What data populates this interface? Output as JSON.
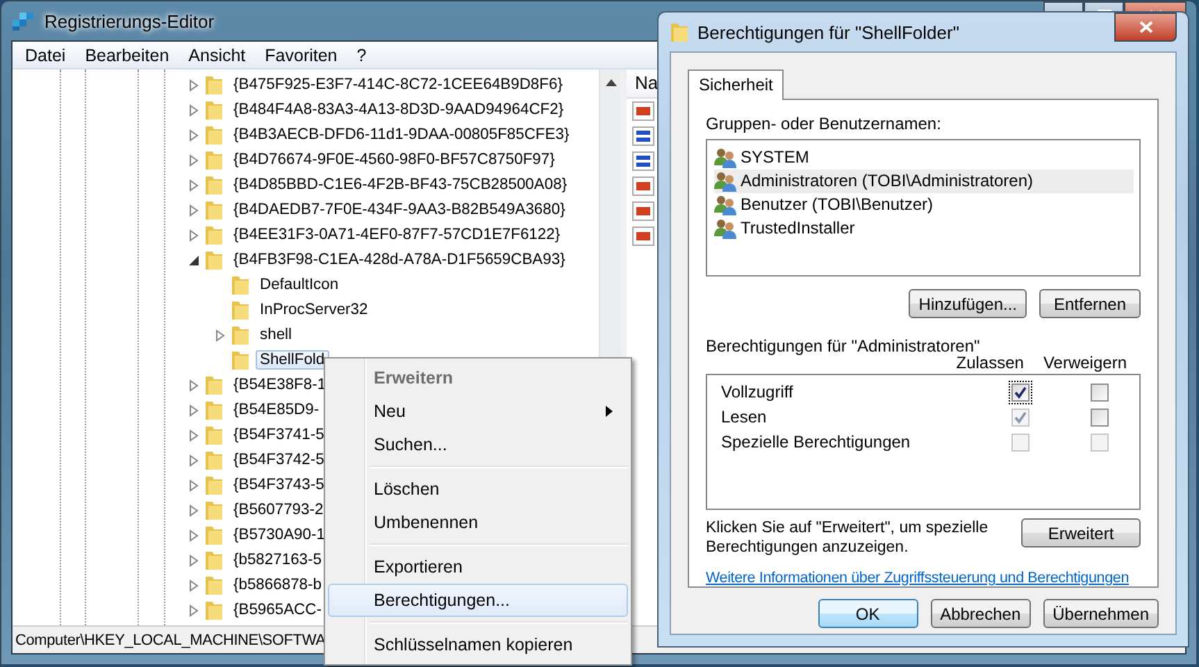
{
  "editor": {
    "title": "Registrierungs-Editor",
    "menu": [
      "Datei",
      "Bearbeiten",
      "Ansicht",
      "Favoriten",
      "?"
    ],
    "tree": [
      {
        "label": "{B475F925-E3F7-414C-8C72-1CEE64B9D8F6}",
        "expanded": false,
        "selected": false
      },
      {
        "label": "{B484F4A8-83A3-4A13-8D3D-9AAD94964CF2}",
        "expanded": false,
        "selected": false
      },
      {
        "label": "{B4B3AECB-DFD6-11d1-9DAA-00805F85CFE3}",
        "expanded": false,
        "selected": false
      },
      {
        "label": "{B4D76674-9F0E-4560-98F0-BF57C8750F97}",
        "expanded": false,
        "selected": false
      },
      {
        "label": "{B4D85BBD-C1E6-4F2B-BF43-75CB28500A08}",
        "expanded": false,
        "selected": false
      },
      {
        "label": "{B4DAEDB7-7F0E-434F-9AA3-B82B549A3680}",
        "expanded": false,
        "selected": false
      },
      {
        "label": "{B4EE31F3-0A71-4EF0-87F7-57CD1E7F6122}",
        "expanded": false,
        "selected": false
      },
      {
        "label": "{B4FB3F98-C1EA-428d-A78A-D1F5659CBA93}",
        "expanded": true,
        "selected": false,
        "children": [
          {
            "label": "DefaultIcon",
            "selected": false
          },
          {
            "label": "InProcServer32",
            "selected": false
          },
          {
            "label": "shell",
            "expanded": false,
            "selected": false
          },
          {
            "label": "ShellFold",
            "selected": true
          }
        ]
      },
      {
        "label": "{B54E38F8-1",
        "expanded": false,
        "selected": false
      },
      {
        "label": "{B54E85D9-",
        "expanded": false,
        "selected": false
      },
      {
        "label": "{B54F3741-5",
        "expanded": false,
        "selected": false
      },
      {
        "label": "{B54F3742-5",
        "expanded": false,
        "selected": false
      },
      {
        "label": "{B54F3743-5",
        "expanded": false,
        "selected": false
      },
      {
        "label": "{B5607793-2",
        "expanded": false,
        "selected": false
      },
      {
        "label": "{B5730A90-1",
        "expanded": false,
        "selected": false
      },
      {
        "label": "{b5827163-5",
        "expanded": false,
        "selected": false
      },
      {
        "label": "{b5866878-b",
        "expanded": false,
        "selected": false
      },
      {
        "label": "{B5965ACC-",
        "expanded": false,
        "selected": false
      }
    ],
    "values": {
      "column_1": "Na",
      "items": [
        {
          "kind": "string"
        },
        {
          "kind": "binary"
        },
        {
          "kind": "binary"
        },
        {
          "kind": "string"
        },
        {
          "kind": "string"
        },
        {
          "kind": "string"
        }
      ]
    },
    "status_bar": "Computer\\HKEY_LOCAL_MACHINE\\SOFTWA"
  },
  "context_menu": {
    "items": [
      {
        "kind": "item",
        "label": "Erweitern",
        "bold": true,
        "disabled": true,
        "submenu": false,
        "selected": false
      },
      {
        "kind": "item",
        "label": "Neu",
        "bold": false,
        "disabled": false,
        "submenu": true,
        "selected": false
      },
      {
        "kind": "item",
        "label": "Suchen...",
        "bold": false,
        "disabled": false,
        "submenu": false,
        "selected": false
      },
      {
        "kind": "separator"
      },
      {
        "kind": "item",
        "label": "Löschen",
        "bold": false,
        "disabled": false,
        "submenu": false,
        "selected": false
      },
      {
        "kind": "item",
        "label": "Umbenennen",
        "bold": false,
        "disabled": false,
        "submenu": false,
        "selected": false
      },
      {
        "kind": "separator"
      },
      {
        "kind": "item",
        "label": "Exportieren",
        "bold": false,
        "disabled": false,
        "submenu": false,
        "selected": false
      },
      {
        "kind": "item",
        "label": "Berechtigungen...",
        "bold": false,
        "disabled": false,
        "submenu": false,
        "selected": true
      },
      {
        "kind": "separator"
      },
      {
        "kind": "item",
        "label": "Schlüsselnamen kopieren",
        "bold": false,
        "disabled": false,
        "submenu": false,
        "selected": false
      }
    ]
  },
  "dialog": {
    "title": "Berechtigungen für \"ShellFolder\"",
    "tabs": [
      {
        "label": "Sicherheit",
        "selected": true
      }
    ],
    "users_label": "Gruppen- oder Benutzernamen:",
    "users": [
      {
        "name": "SYSTEM",
        "selected": false
      },
      {
        "name": "Administratoren (TOBI\\Administratoren)",
        "selected": true
      },
      {
        "name": "Benutzer (TOBI\\Benutzer)",
        "selected": false
      },
      {
        "name": "TrustedInstaller",
        "selected": false
      }
    ],
    "user_buttons": [
      "Hinzufügen...",
      "Entfernen"
    ],
    "permissions_label": "Berechtigungen für \"Administratoren\"",
    "columns": [
      "Zulassen",
      "Verweigern"
    ],
    "permissions": [
      {
        "name": "Vollzugriff",
        "allow": {
          "checked": true,
          "disabled": false
        },
        "deny": {
          "checked": false,
          "disabled": false
        }
      },
      {
        "name": "Lesen",
        "allow": {
          "checked": true,
          "disabled": true
        },
        "deny": {
          "checked": false,
          "disabled": false
        }
      },
      {
        "name": "Spezielle Berechtigungen",
        "allow": {
          "checked": false,
          "disabled": true
        },
        "deny": {
          "checked": false,
          "disabled": true
        }
      }
    ],
    "advanced_hint": "Klicken Sie auf \"Erweitert\", um spezielle Berechtigungen anzuzeigen.",
    "advanced_button": "Erweitert",
    "link": "Weitere Informationen über Zugriffssteuerung und Berechtigungen",
    "buttons": [
      "OK",
      "Abbrechen",
      "Übernehmen"
    ]
  }
}
